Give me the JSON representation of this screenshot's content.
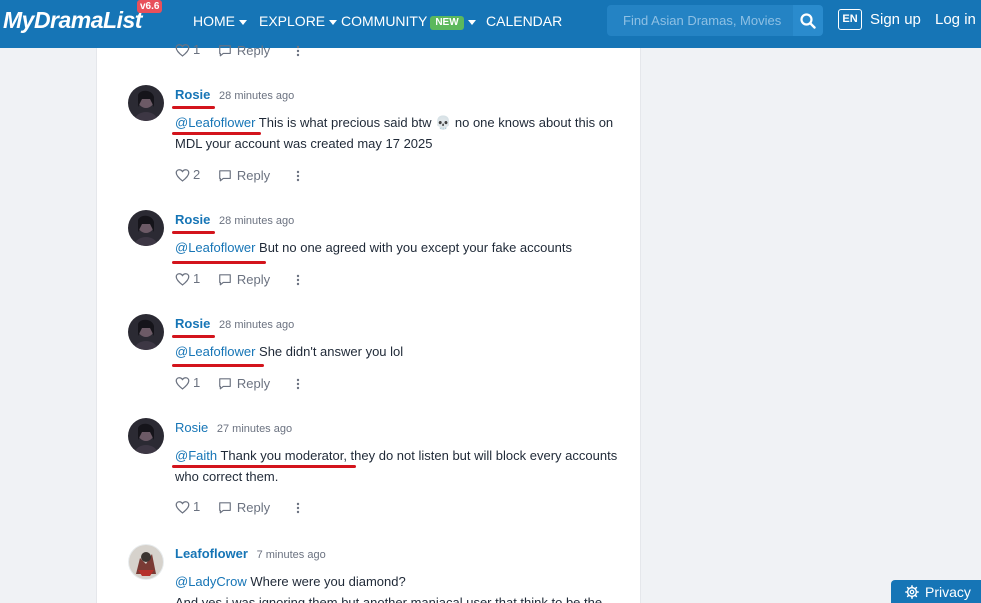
{
  "navbar": {
    "logo": "MyDramaList",
    "version": "v6.6",
    "nav": {
      "home": "HOME",
      "explore": "EXPLORE",
      "community": "COMMUNITY",
      "new_badge": "NEW",
      "calendar": "CALENDAR"
    },
    "search_placeholder": "Find Asian Dramas, Movies",
    "lang": "EN",
    "signup": "Sign up",
    "login": "Log in"
  },
  "top_actions": {
    "likes": "1",
    "reply": "Reply"
  },
  "comments": [
    {
      "author": "Rosie",
      "time": "28 minutes ago",
      "mention": "@Leafoflower",
      "text": " This is what precious said btw 💀 no one knows about this on MDL your account was created may 17 2025",
      "likes": "2",
      "reply": "Reply"
    },
    {
      "author": "Rosie",
      "time": "28 minutes ago",
      "mention": "@Leafoflower",
      "text": " But no one agreed with you except your fake accounts",
      "likes": "1",
      "reply": "Reply"
    },
    {
      "author": "Rosie",
      "time": "28 minutes ago",
      "mention": "@Leafoflower",
      "text": " She didn't answer you lol",
      "likes": "1",
      "reply": "Reply"
    },
    {
      "author": "Rosie",
      "time": "27 minutes ago",
      "mention": "@Faith",
      "text": " Thank you moderator, they do not listen but will block every accounts who correct them.",
      "likes": "1",
      "reply": "Reply"
    },
    {
      "author": "Leafoflower",
      "time": "7 minutes ago",
      "mention": "@LadyCrow",
      "text": " Where were you diamond?",
      "text2": "And yes i was ignoring them but another maniacal user that think to be the"
    }
  ],
  "privacy": "Privacy",
  "colors": {
    "brand": "#1675b6",
    "annotation_red": "#d3141c",
    "new_badge": "#5cb85c"
  }
}
